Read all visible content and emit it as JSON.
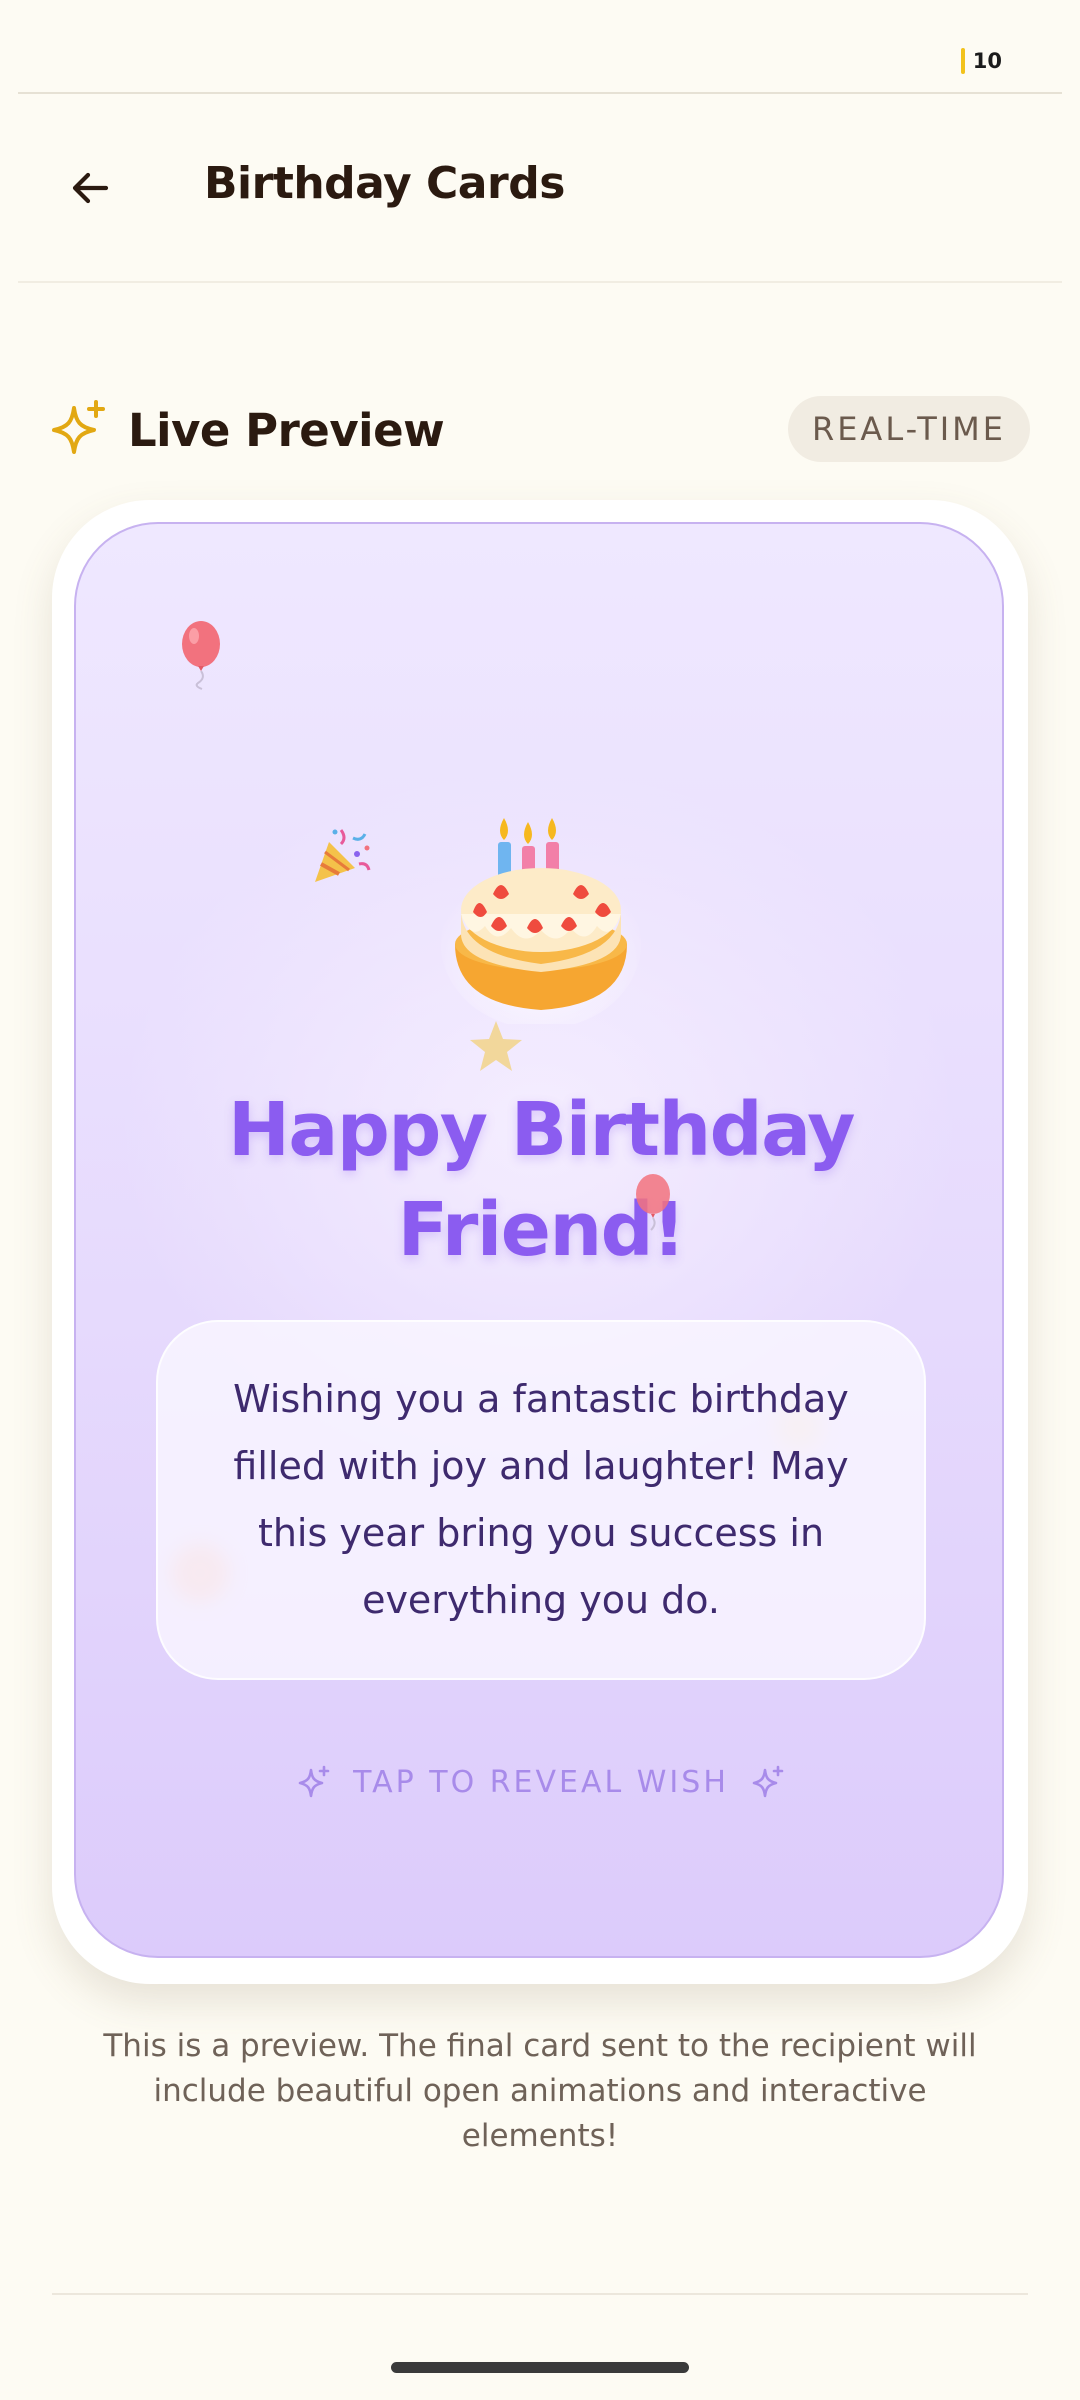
{
  "status_bar": {
    "battery_level": "10",
    "battery_color": "#F2C21B"
  },
  "header": {
    "title": "Birthday Cards",
    "back_icon": "arrow-left-icon"
  },
  "section": {
    "title": "Live Preview",
    "icon": "sparkle-icon",
    "badge": "REAL-TIME"
  },
  "card": {
    "greeting_line1": "Happy Birthday",
    "greeting_line2": "Friend!",
    "message": "Wishing you a fantastic birthday filled with joy and laughter! May this year bring you success in everything you do.",
    "tap_label": "TAP TO REVEAL WISH",
    "decorations": [
      "balloon-icon",
      "party-popper-icon",
      "birthday-cake-icon",
      "star-icon",
      "balloon-icon"
    ],
    "colors": {
      "greeting": "#8B5CF0",
      "background_top": "#EFE8FF",
      "background_bottom": "#DCCBFB",
      "border": "#C7B2F0"
    }
  },
  "caption": "This is a preview. The final card sent to the recipient will include beautiful open animations and interactive elements!",
  "colors": {
    "page_background": "#FDFBF3",
    "accent_gold": "#E2A812"
  }
}
